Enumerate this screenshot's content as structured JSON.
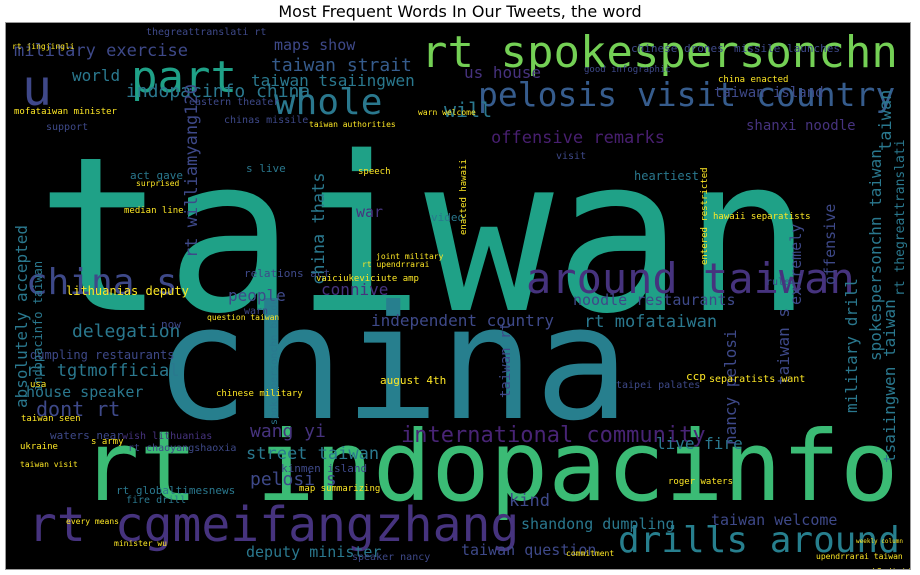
{
  "chart_data": {
    "type": "wordcloud",
    "title": "Most Frequent Words In Our Tweets, the word",
    "background": "#000000",
    "colormap": "viridis",
    "words": [
      {
        "text": "taiwan",
        "weight": 1.0,
        "color": "#1fa187",
        "vertical": false
      },
      {
        "text": "china",
        "weight": 0.85,
        "color": "#277f8e",
        "vertical": false
      },
      {
        "text": "rt indopacinfo",
        "weight": 0.62,
        "color": "#3bbb75",
        "vertical": false
      },
      {
        "text": "rt spokespersonchn",
        "weight": 0.34,
        "color": "#74d055",
        "vertical": false
      },
      {
        "text": "rt cgmeifangzhang",
        "weight": 0.3,
        "color": "#46337e",
        "vertical": false
      },
      {
        "text": "part",
        "weight": 0.26,
        "color": "#1fa187",
        "vertical": false
      },
      {
        "text": "u",
        "weight": 0.28,
        "color": "#3f4889",
        "vertical": false
      },
      {
        "text": "around taiwan",
        "weight": 0.24,
        "color": "#46337e",
        "vertical": false
      },
      {
        "text": "drills around",
        "weight": 0.24,
        "color": "#277f8e",
        "vertical": false
      },
      {
        "text": "whole",
        "weight": 0.2,
        "color": "#2a788e",
        "vertical": false
      },
      {
        "text": "pelosis visit country",
        "weight": 0.19,
        "color": "#365c8d",
        "vertical": false
      },
      {
        "text": "china s",
        "weight": 0.2,
        "color": "#3e4989",
        "vertical": false
      },
      {
        "text": "international community",
        "weight": 0.12,
        "color": "#482475",
        "vertical": false
      },
      {
        "text": "taiwan strait",
        "weight": 0.11,
        "color": "#365c8d",
        "vertical": false
      },
      {
        "text": "taiwan tsaiingwen",
        "weight": 0.09,
        "color": "#2a788e",
        "vertical": false
      },
      {
        "text": "military exercise",
        "weight": 0.09,
        "color": "#3e4989",
        "vertical": false
      },
      {
        "text": "indopacinfo china",
        "weight": 0.1,
        "color": "#2a788e",
        "vertical": false
      },
      {
        "text": "maps show",
        "weight": 0.08,
        "color": "#3e4989",
        "vertical": false
      },
      {
        "text": "offensive remarks",
        "weight": 0.09,
        "color": "#481f70",
        "vertical": false
      },
      {
        "text": "will",
        "weight": 0.1,
        "color": "#2a788e",
        "vertical": false
      },
      {
        "text": "us house",
        "weight": 0.09,
        "color": "#46327e",
        "vertical": false
      },
      {
        "text": "taiwan island",
        "weight": 0.08,
        "color": "#3e4989",
        "vertical": false
      },
      {
        "text": "shanxi noodle",
        "weight": 0.08,
        "color": "#46337e",
        "vertical": false
      },
      {
        "text": "world",
        "weight": 0.08,
        "color": "#2a788e",
        "vertical": false
      },
      {
        "text": "independent country",
        "weight": 0.09,
        "color": "#3e4989",
        "vertical": false
      },
      {
        "text": "rt mofataiwan",
        "weight": 0.1,
        "color": "#2a788e",
        "vertical": false
      },
      {
        "text": "delegation",
        "weight": 0.09,
        "color": "#2a788e",
        "vertical": false
      },
      {
        "text": "people",
        "weight": 0.08,
        "color": "#3e4989",
        "vertical": false
      },
      {
        "text": "connive",
        "weight": 0.08,
        "color": "#46337e",
        "vertical": false
      },
      {
        "text": "noodle restaurants",
        "weight": 0.08,
        "color": "#3e4989",
        "vertical": false
      },
      {
        "text": "rt tgtmofficial",
        "weight": 0.09,
        "color": "#2a788e",
        "vertical": false
      },
      {
        "text": "dont rt",
        "weight": 0.1,
        "color": "#3e4989",
        "vertical": false
      },
      {
        "text": "house speaker",
        "weight": 0.08,
        "color": "#2a788e",
        "vertical": false
      },
      {
        "text": "wang yi",
        "weight": 0.09,
        "color": "#46337e",
        "vertical": false
      },
      {
        "text": "street taiwan",
        "weight": 0.09,
        "color": "#2a788e",
        "vertical": false
      },
      {
        "text": "pelosi s",
        "weight": 0.09,
        "color": "#3e4989",
        "vertical": false
      },
      {
        "text": "live fire",
        "weight": 0.08,
        "color": "#2a788e",
        "vertical": false
      },
      {
        "text": "kind",
        "weight": 0.09,
        "color": "#3e4989",
        "vertical": false
      },
      {
        "text": "shandong dumpling",
        "weight": 0.08,
        "color": "#2a788e",
        "vertical": false
      },
      {
        "text": "taiwan welcome",
        "weight": 0.08,
        "color": "#3e4989",
        "vertical": false
      },
      {
        "text": "taiwan question",
        "weight": 0.08,
        "color": "#3e4989",
        "vertical": false
      },
      {
        "text": "deputy minister",
        "weight": 0.08,
        "color": "#2a788e",
        "vertical": false
      },
      {
        "text": "lithuanias deputy",
        "weight": 0.06,
        "color": "#fde725",
        "vertical": false
      },
      {
        "text": "dumpling restaurants",
        "weight": 0.06,
        "color": "#3e4989",
        "vertical": false
      },
      {
        "text": "rt globaltimesnews",
        "weight": 0.06,
        "color": "#2a788e",
        "vertical": false
      },
      {
        "text": "relations act",
        "weight": 0.05,
        "color": "#3e4989",
        "vertical": false
      },
      {
        "text": "war",
        "weight": 0.07,
        "color": "#46337e",
        "vertical": false
      },
      {
        "text": "video",
        "weight": 0.05,
        "color": "#2a788e",
        "vertical": false
      },
      {
        "text": "heartiest",
        "weight": 0.05,
        "color": "#2a788e",
        "vertical": false
      },
      {
        "text": "visit",
        "weight": 0.05,
        "color": "#3e4989",
        "vertical": false
      },
      {
        "text": "act gave",
        "weight": 0.05,
        "color": "#2a788e",
        "vertical": false
      },
      {
        "text": "s live",
        "weight": 0.05,
        "color": "#2a788e",
        "vertical": false
      },
      {
        "text": "ccp",
        "weight": 0.05,
        "color": "#fde725",
        "vertical": false
      },
      {
        "text": "august 4th",
        "weight": 0.05,
        "color": "#fde725",
        "vertical": false
      },
      {
        "text": "eastern theater",
        "weight": 0.05,
        "color": "#3e4989",
        "vertical": false
      },
      {
        "text": "rt chaoyangshaoxia",
        "weight": 0.05,
        "color": "#3e4989",
        "vertical": false
      },
      {
        "text": "wish lithuanias",
        "weight": 0.05,
        "color": "#46337e",
        "vertical": false
      },
      {
        "text": "waters near",
        "weight": 0.05,
        "color": "#3e4989",
        "vertical": false
      },
      {
        "text": "kinmen island",
        "weight": 0.05,
        "color": "#3e4989",
        "vertical": false
      },
      {
        "text": "fire drill",
        "weight": 0.05,
        "color": "#2a788e",
        "vertical": false
      },
      {
        "text": "rt williamyang120",
        "weight": 0.12,
        "color": "#3e4989",
        "vertical": true
      },
      {
        "text": "china thats",
        "weight": 0.12,
        "color": "#2a788e",
        "vertical": true
      },
      {
        "text": "absolutely accepted",
        "weight": 0.11,
        "color": "#2a788e",
        "vertical": true
      },
      {
        "text": "indopacinfo taiwan",
        "weight": 0.08,
        "color": "#2a788e",
        "vertical": true
      },
      {
        "text": "spokespersonchn taiwan",
        "weight": 0.11,
        "color": "#2a788e",
        "vertical": true
      },
      {
        "text": "military drill",
        "weight": 0.1,
        "color": "#2a788e",
        "vertical": true
      },
      {
        "text": "nancy pelosi",
        "weight": 0.1,
        "color": "#3e4989",
        "vertical": true
      },
      {
        "text": "taiwan s",
        "weight": 0.1,
        "color": "#3e4989",
        "vertical": true
      },
      {
        "text": "taiwan rt",
        "weight": 0.08,
        "color": "#3e4989",
        "vertical": true
      },
      {
        "text": "offensive",
        "weight": 0.08,
        "color": "#3e4989",
        "vertical": true
      },
      {
        "text": "extremely",
        "weight": 0.08,
        "color": "#3e4989",
        "vertical": true
      },
      {
        "text": "rt thegreattranslati",
        "weight": 0.08,
        "color": "#2a788e",
        "vertical": true
      },
      {
        "text": "tsaiingwen taiwan",
        "weight": 0.09,
        "color": "#2a788e",
        "vertical": true
      },
      {
        "text": "taiwan",
        "weight": 0.09,
        "color": "#2a788e",
        "vertical": true
      },
      {
        "text": "spokespersonchn baidu",
        "weight": 0.04,
        "color": "#2a788e",
        "vertical": true
      },
      {
        "text": "thegreattranslati rt",
        "weight": 0.04,
        "color": "#3e4989",
        "vertical": false
      },
      {
        "text": "chinese drones",
        "weight": 0.04,
        "color": "#3e4989",
        "vertical": false
      },
      {
        "text": "missile launches",
        "weight": 0.04,
        "color": "#3e4989",
        "vertical": false
      },
      {
        "text": "good infographic",
        "weight": 0.04,
        "color": "#3e4989",
        "vertical": false
      },
      {
        "text": "china enacted",
        "weight": 0.03,
        "color": "#fde725",
        "vertical": false
      },
      {
        "text": "mofataiwan minister",
        "weight": 0.03,
        "color": "#fde725",
        "vertical": false
      },
      {
        "text": "chinas missile",
        "weight": 0.04,
        "color": "#3e4989",
        "vertical": false
      },
      {
        "text": "rt jingjingli",
        "weight": 0.03,
        "color": "#fde725",
        "vertical": false
      },
      {
        "text": "warn welcome",
        "weight": 0.03,
        "color": "#fde725",
        "vertical": false
      },
      {
        "text": "taiwan authorities",
        "weight": 0.03,
        "color": "#fde725",
        "vertical": false
      },
      {
        "text": "rt upendrrarai",
        "weight": 0.03,
        "color": "#fde725",
        "vertical": false
      },
      {
        "text": "joint military",
        "weight": 0.03,
        "color": "#fde725",
        "vertical": false
      },
      {
        "text": "vaiciukeviciute amp",
        "weight": 0.03,
        "color": "#fde725",
        "vertical": false
      },
      {
        "text": "question taiwan",
        "weight": 0.03,
        "color": "#fde725",
        "vertical": false
      },
      {
        "text": "separatists want",
        "weight": 0.03,
        "color": "#fde725",
        "vertical": false
      },
      {
        "text": "entered restricted",
        "weight": 0.03,
        "color": "#fde725",
        "vertical": true
      },
      {
        "text": "enacted hawaii",
        "weight": 0.03,
        "color": "#fde725",
        "vertical": true
      },
      {
        "text": "hawaii separatists",
        "weight": 0.03,
        "color": "#fde725",
        "vertical": false
      },
      {
        "text": "median line",
        "weight": 0.03,
        "color": "#fde725",
        "vertical": false
      },
      {
        "text": "speaker nancy",
        "weight": 0.04,
        "color": "#3e4989",
        "vertical": false
      },
      {
        "text": "beijing",
        "weight": 0.04,
        "color": "#3e4989",
        "vertical": false
      },
      {
        "text": "roger waters",
        "weight": 0.03,
        "color": "#fde725",
        "vertical": false
      },
      {
        "text": "chinese military",
        "weight": 0.03,
        "color": "#fde725",
        "vertical": false
      },
      {
        "text": "surprised",
        "weight": 0.03,
        "color": "#fde725",
        "vertical": false
      },
      {
        "text": "map summarizing",
        "weight": 0.03,
        "color": "#fde725",
        "vertical": false
      },
      {
        "text": "taiwan seen",
        "weight": 0.03,
        "color": "#fde725",
        "vertical": false
      },
      {
        "text": "s army",
        "weight": 0.03,
        "color": "#fde725",
        "vertical": false
      },
      {
        "text": "weekly column",
        "weight": 0.03,
        "color": "#fde725",
        "vertical": false
      },
      {
        "text": "upendrrarai taiwan",
        "weight": 0.03,
        "color": "#fde725",
        "vertical": false
      },
      {
        "text": "overseaspk2 divide",
        "weight": 0.03,
        "color": "#fde725",
        "vertical": false
      },
      {
        "text": "speech",
        "weight": 0.03,
        "color": "#fde725",
        "vertical": false
      },
      {
        "text": "support",
        "weight": 0.04,
        "color": "#3e4989",
        "vertical": false
      },
      {
        "text": "rule",
        "weight": 0.04,
        "color": "#3e4989",
        "vertical": false
      },
      {
        "text": "now",
        "weight": 0.05,
        "color": "#3e4989",
        "vertical": false
      },
      {
        "text": "warn",
        "weight": 0.04,
        "color": "#3e4989",
        "vertical": false
      },
      {
        "text": "usa",
        "weight": 0.03,
        "color": "#fde725",
        "vertical": false
      },
      {
        "text": "ukraine",
        "weight": 0.03,
        "color": "#fde725",
        "vertical": false
      },
      {
        "text": "taiwan visit",
        "weight": 0.03,
        "color": "#fde725",
        "vertical": false
      },
      {
        "text": "every means",
        "weight": 0.03,
        "color": "#fde725",
        "vertical": false
      },
      {
        "text": "minister wu",
        "weight": 0.03,
        "color": "#fde725",
        "vertical": false
      },
      {
        "text": "taipei palates",
        "weight": 0.03,
        "color": "#3e4989",
        "vertical": false
      },
      {
        "text": "commitment",
        "weight": 0.03,
        "color": "#fde725",
        "vertical": false
      },
      {
        "text": "phenomenon associated",
        "weight": 0.03,
        "color": "#fde725",
        "vertical": false
      }
    ]
  }
}
